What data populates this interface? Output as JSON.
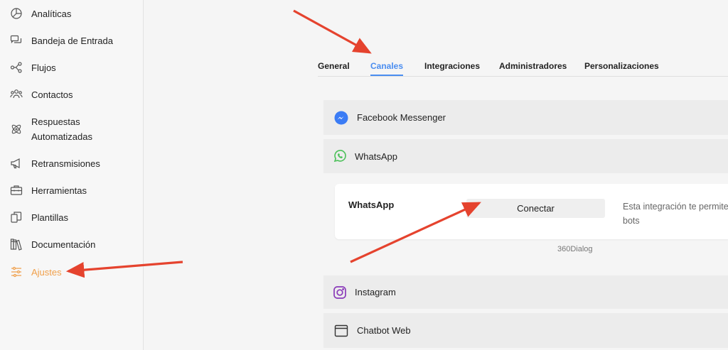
{
  "sidebar": {
    "items": [
      {
        "label": "Analíticas",
        "icon": "pie-chart-icon"
      },
      {
        "label": "Bandeja de Entrada",
        "icon": "chat-bubbles-icon"
      },
      {
        "label": "Flujos",
        "icon": "flow-nodes-icon"
      },
      {
        "label": "Contactos",
        "icon": "people-icon"
      },
      {
        "label_line1": "Respuestas",
        "label_line2": "Automatizadas",
        "icon": "atom-icon"
      },
      {
        "label": "Retransmisiones",
        "icon": "megaphone-icon"
      },
      {
        "label": "Herramientas",
        "icon": "toolbox-icon"
      },
      {
        "label": "Plantillas",
        "icon": "templates-icon"
      },
      {
        "label": "Documentación",
        "icon": "books-icon"
      },
      {
        "label": "Ajustes",
        "icon": "sliders-icon",
        "active": true
      }
    ]
  },
  "tabs": [
    {
      "label": "General"
    },
    {
      "label": "Canales",
      "active": true
    },
    {
      "label": "Integraciones"
    },
    {
      "label": "Administradores"
    },
    {
      "label": "Personalizaciones"
    }
  ],
  "channels": {
    "facebook": {
      "name": "Facebook Messenger",
      "icon": "messenger-icon",
      "color": "#3b7cf5"
    },
    "whatsapp": {
      "name": "WhatsApp",
      "icon": "whatsapp-icon",
      "color": "#4cc15a"
    },
    "instagram": {
      "name": "Instagram",
      "icon": "instagram-icon",
      "color": "#8a3ab9"
    },
    "chatbot_web": {
      "name": "Chatbot Web",
      "icon": "browser-window-icon"
    }
  },
  "whatsapp_panel": {
    "title": "WhatsApp",
    "connect_label": "Conectar",
    "description_line1": "Esta integración te permite",
    "description_line2": "bots",
    "provider": "360Dialog"
  },
  "colors": {
    "accent_blue": "#4a8df0",
    "active_orange": "#f0a04b",
    "annotation_red": "#e5432e"
  }
}
